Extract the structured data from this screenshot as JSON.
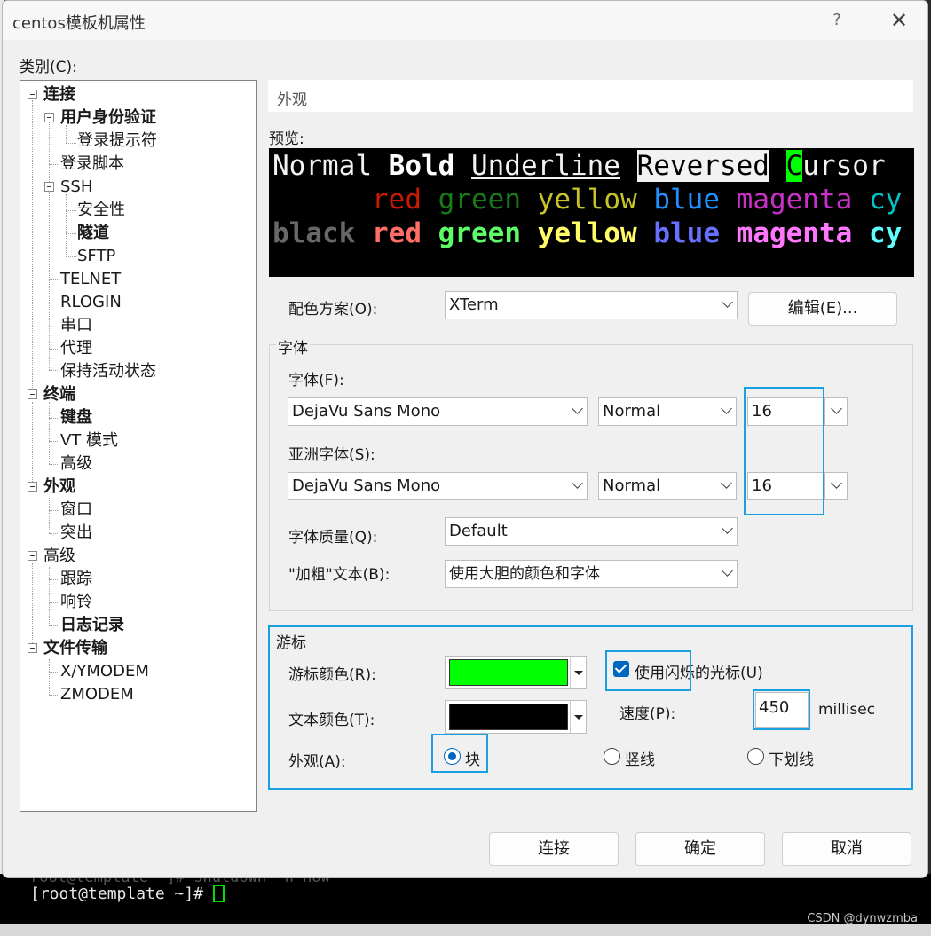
{
  "window": {
    "title": "centos模板机属性",
    "help": "?",
    "close": "✕"
  },
  "category_label": "类别(C):",
  "tree": [
    {
      "label": "连接",
      "bold": true
    },
    {
      "label": "用户身份验证",
      "bold": true
    },
    {
      "label": "登录提示符",
      "bold": false
    },
    {
      "label": "登录脚本",
      "bold": false
    },
    {
      "label": "SSH",
      "bold": false
    },
    {
      "label": "安全性",
      "bold": false
    },
    {
      "label": "隧道",
      "bold": true
    },
    {
      "label": "SFTP",
      "bold": false
    },
    {
      "label": "TELNET",
      "bold": false
    },
    {
      "label": "RLOGIN",
      "bold": false
    },
    {
      "label": "串口",
      "bold": false
    },
    {
      "label": "代理",
      "bold": false
    },
    {
      "label": "保持活动状态",
      "bold": false
    },
    {
      "label": "终端",
      "bold": true
    },
    {
      "label": "键盘",
      "bold": true
    },
    {
      "label": "VT 模式",
      "bold": false
    },
    {
      "label": "高级",
      "bold": false
    },
    {
      "label": "外观",
      "bold": true
    },
    {
      "label": "窗口",
      "bold": false
    },
    {
      "label": "突出",
      "bold": false
    },
    {
      "label": "高级",
      "bold": false
    },
    {
      "label": "跟踪",
      "bold": false
    },
    {
      "label": "响铃",
      "bold": false
    },
    {
      "label": "日志记录",
      "bold": true
    },
    {
      "label": "文件传输",
      "bold": true
    },
    {
      "label": "X/YMODEM",
      "bold": false
    },
    {
      "label": "ZMODEM",
      "bold": false
    }
  ],
  "section_title": "外观",
  "preview": {
    "label": "预览:",
    "normal": "Normal",
    "bold": "Bold",
    "underline": "Underline",
    "reversed": "Reversed",
    "cursor_char": "C",
    "cursor_rest": "ursor",
    "colors_row1": [
      {
        "text": "red",
        "color": "#c91b00"
      },
      {
        "text": "green",
        "color": "#1a7a1a"
      },
      {
        "text": "yellow",
        "color": "#c7c329"
      },
      {
        "text": "blue",
        "color": "#1e90ff"
      },
      {
        "text": "magenta",
        "color": "#c930c7"
      },
      {
        "text": "cy",
        "color": "#00c5c7"
      }
    ],
    "black": {
      "text": "black",
      "color": "#686868"
    },
    "colors_row2": [
      {
        "text": "red",
        "color": "#ff6e67"
      },
      {
        "text": "green",
        "color": "#5ffa68"
      },
      {
        "text": "yellow",
        "color": "#fffc67"
      },
      {
        "text": "blue",
        "color": "#6871ff"
      },
      {
        "text": "magenta",
        "color": "#ff77ff"
      },
      {
        "text": "cy",
        "color": "#60fdff"
      }
    ]
  },
  "color_scheme": {
    "label": "配色方案(O):",
    "value": "XTerm",
    "edit_button": "编辑(E)..."
  },
  "font_group": {
    "title": "字体",
    "font_label": "字体(F):",
    "font_value": "DejaVu Sans Mono",
    "font_style": "Normal",
    "font_size": "16",
    "asian_label": "亚洲字体(S):",
    "asian_value": "DejaVu Sans Mono",
    "asian_style": "Normal",
    "asian_size": "16",
    "quality_label": "字体质量(Q):",
    "quality_value": "Default",
    "bold_label": "\"加粗\"文本(B):",
    "bold_value": "使用大胆的颜色和字体"
  },
  "cursor_group": {
    "title": "游标",
    "cursor_color_label": "游标颜色(R):",
    "cursor_color": "#00ff00",
    "text_color_label": "文本颜色(T):",
    "text_color": "#000000",
    "blink_label": "使用闪烁的光标(U)",
    "speed_label": "速度(P):",
    "speed_value": "450",
    "speed_unit": "millisec",
    "appearance_label": "外观(A):",
    "opt_block": "块",
    "opt_vline": "竖线",
    "opt_underline": "下划线"
  },
  "buttons": {
    "connect": "连接",
    "ok": "确定",
    "cancel": "取消"
  },
  "terminal": {
    "faded": "root@template ~]# shutdown -h now",
    "prompt": "[root@template ~]#",
    "watermark": "CSDN @dynwzmba"
  }
}
